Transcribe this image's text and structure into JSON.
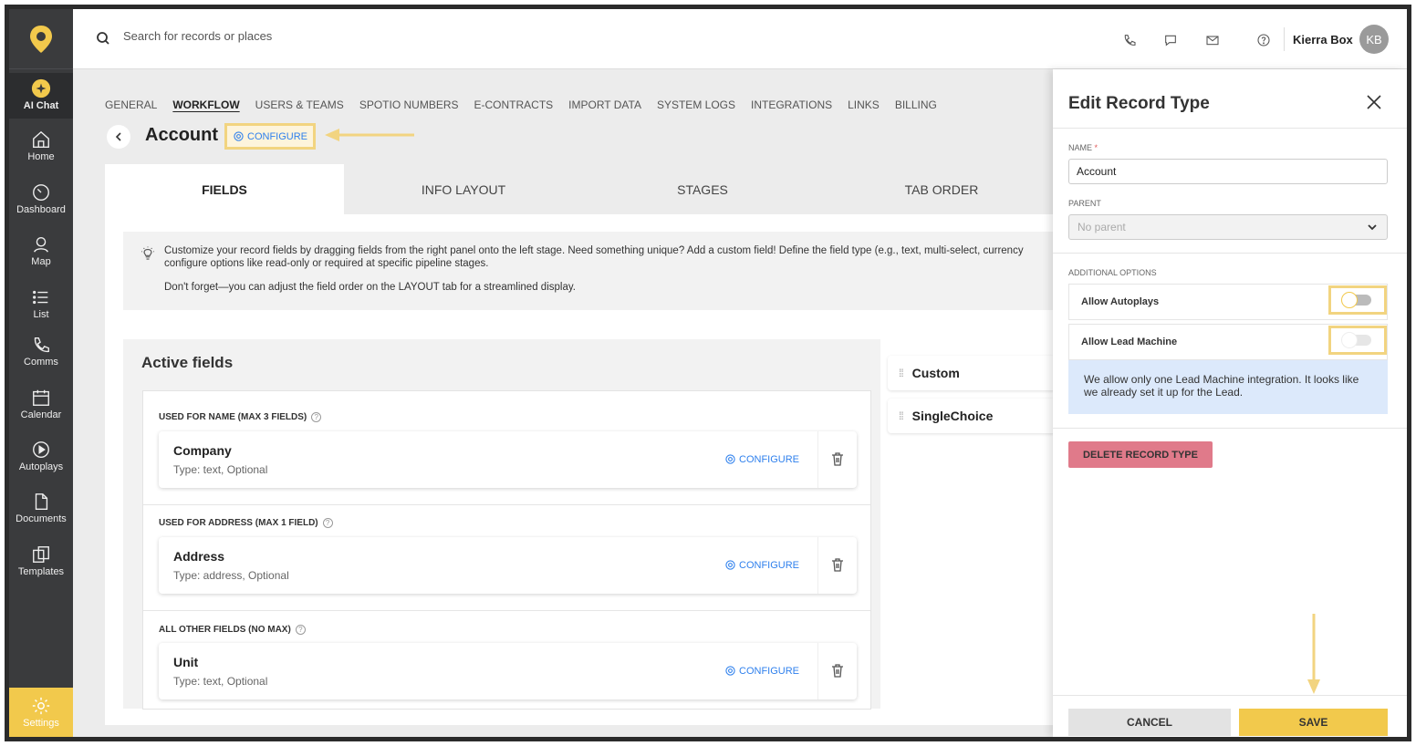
{
  "sidebar": {
    "items": [
      {
        "label": "AI Chat",
        "icon": "sparkle-icon"
      },
      {
        "label": "Home",
        "icon": "home-icon"
      },
      {
        "label": "Dashboard",
        "icon": "dashboard-icon"
      },
      {
        "label": "Map",
        "icon": "map-pin-icon"
      },
      {
        "label": "List",
        "icon": "list-icon"
      },
      {
        "label": "Comms",
        "icon": "phone-icon"
      },
      {
        "label": "Calendar",
        "icon": "calendar-icon"
      },
      {
        "label": "Autoplays",
        "icon": "play-icon"
      },
      {
        "label": "Documents",
        "icon": "document-icon"
      },
      {
        "label": "Templates",
        "icon": "templates-icon"
      }
    ],
    "settings_label": "Settings"
  },
  "topbar": {
    "search_placeholder": "Search for records or places",
    "user_name": "Kierra Box",
    "user_initials": "KB"
  },
  "settings_nav": [
    "GENERAL",
    "WORKFLOW",
    "USERS & TEAMS",
    "SPOTIO NUMBERS",
    "E-CONTRACTS",
    "IMPORT DATA",
    "SYSTEM LOGS",
    "INTEGRATIONS",
    "LINKS",
    "BILLING"
  ],
  "page": {
    "title": "Account",
    "configure_label": "CONFIGURE"
  },
  "tabs": [
    "FIELDS",
    "INFO LAYOUT",
    "STAGES",
    "TAB ORDER"
  ],
  "info": {
    "line1": "Customize your record fields by dragging fields from the right panel onto the left stage. Need something unique? Add a custom field! Define the field type (e.g., text, multi-select, currency",
    "line1b": "configure options like read-only or required at specific pipeline stages.",
    "line2": "Don't forget—you can adjust the field order on the LAYOUT tab for a streamlined display."
  },
  "active_fields": {
    "title": "Active fields",
    "sections": [
      {
        "label": "USED FOR NAME (MAX 3 FIELDS)",
        "field": {
          "name": "Company",
          "type": "Type: text, Optional"
        }
      },
      {
        "label": "USED FOR ADDRESS (MAX 1 FIELD)",
        "field": {
          "name": "Address",
          "type": "Type: address, Optional"
        }
      },
      {
        "label": "ALL OTHER FIELDS (NO MAX)",
        "field": {
          "name": "Unit",
          "type": "Type: text, Optional"
        }
      }
    ],
    "configure_label": "CONFIGURE"
  },
  "available_fields": [
    "Custom",
    "SingleChoice"
  ],
  "panel": {
    "title": "Edit Record Type",
    "name_label": "NAME",
    "name_value": "Account",
    "parent_label": "PARENT",
    "parent_placeholder": "No parent",
    "additional_label": "ADDITIONAL OPTIONS",
    "option1": "Allow Autoplays",
    "option2": "Allow Lead Machine",
    "notice": "We allow only one Lead Machine integration. It looks like we already set it up for the Lead.",
    "delete_label": "DELETE RECORD TYPE",
    "cancel_label": "CANCEL",
    "save_label": "SAVE"
  },
  "colors": {
    "accent": "#F2C94C",
    "link": "#2F80ED",
    "danger": "#E07A8A",
    "sidebar": "#3A3B3D"
  }
}
